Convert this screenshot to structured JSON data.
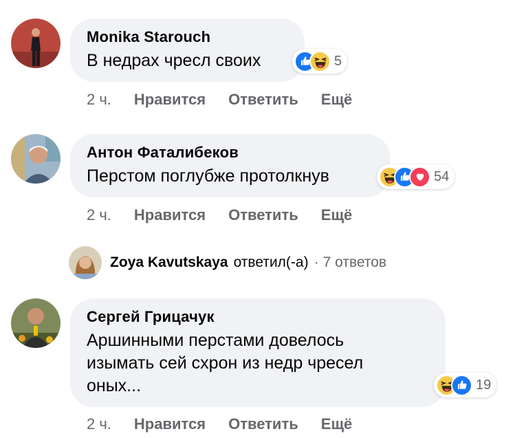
{
  "comments": [
    {
      "author": "Monika Starouch",
      "text": "В недрах чресл своих",
      "reaction_count": "5",
      "reactions": [
        "like-icon",
        "haha-icon"
      ],
      "actions": {
        "time": "2 ч.",
        "like": "Нравится",
        "reply": "Ответить",
        "more": "Ещё"
      }
    },
    {
      "author": "Антон Фаталибеков",
      "text": "Перстом поглубже протолкнув",
      "reaction_count": "54",
      "reactions": [
        "haha-icon",
        "like-icon",
        "love-icon"
      ],
      "actions": {
        "time": "2 ч.",
        "like": "Нравится",
        "reply": "Ответить",
        "more": "Ещё"
      }
    },
    {
      "author": "Сергей Грицачук",
      "text_lines": [
        "Аршинными перстами довелось",
        "изымать сей схрон из недр чресел",
        "оных..."
      ],
      "reaction_count": "19",
      "reactions": [
        "haha-icon",
        "like-icon"
      ],
      "actions": {
        "time": "2 ч.",
        "like": "Нравится",
        "reply": "Ответить",
        "more": "Ещё"
      }
    }
  ],
  "reply_summary": {
    "name": "Zoya Kavutskaya",
    "verb": "ответил(-а)",
    "separator": "·",
    "count": "7 ответов"
  }
}
